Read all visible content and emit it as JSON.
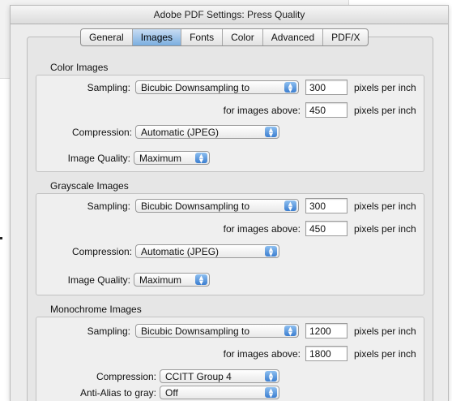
{
  "window": {
    "title": "Adobe PDF Settings: Press Quality"
  },
  "tabs": [
    {
      "label": "General"
    },
    {
      "label": "Images"
    },
    {
      "label": "Fonts"
    },
    {
      "label": "Color"
    },
    {
      "label": "Advanced"
    },
    {
      "label": "PDF/X"
    }
  ],
  "active_tab": "Images",
  "color_images": {
    "title": "Color Images",
    "sampling_label": "Sampling:",
    "sampling_value": "Bicubic Downsampling to",
    "sampling_ppi": "300",
    "ppi_unit": "pixels per inch",
    "above_label": "for images above:",
    "above_value": "450",
    "compression_label": "Compression:",
    "compression_value": "Automatic (JPEG)",
    "quality_label": "Image Quality:",
    "quality_value": "Maximum"
  },
  "grayscale_images": {
    "title": "Grayscale Images",
    "sampling_label": "Sampling:",
    "sampling_value": "Bicubic Downsampling to",
    "sampling_ppi": "300",
    "ppi_unit": "pixels per inch",
    "above_label": "for images above:",
    "above_value": "450",
    "compression_label": "Compression:",
    "compression_value": "Automatic (JPEG)",
    "quality_label": "Image Quality:",
    "quality_value": "Maximum"
  },
  "monochrome_images": {
    "title": "Monochrome Images",
    "sampling_label": "Sampling:",
    "sampling_value": "Bicubic Downsampling to",
    "sampling_ppi": "1200",
    "ppi_unit": "pixels per inch",
    "above_label": "for images above:",
    "above_value": "1800",
    "compression_label": "Compression:",
    "compression_value": "CCITT Group 4",
    "antialias_label": "Anti-Alias to gray:",
    "antialias_value": "Off"
  },
  "icons": {
    "popup_arrows": "up-down-arrows-icon"
  },
  "colors": {
    "accent": "#5a97dd",
    "window_bg": "#ececec"
  }
}
